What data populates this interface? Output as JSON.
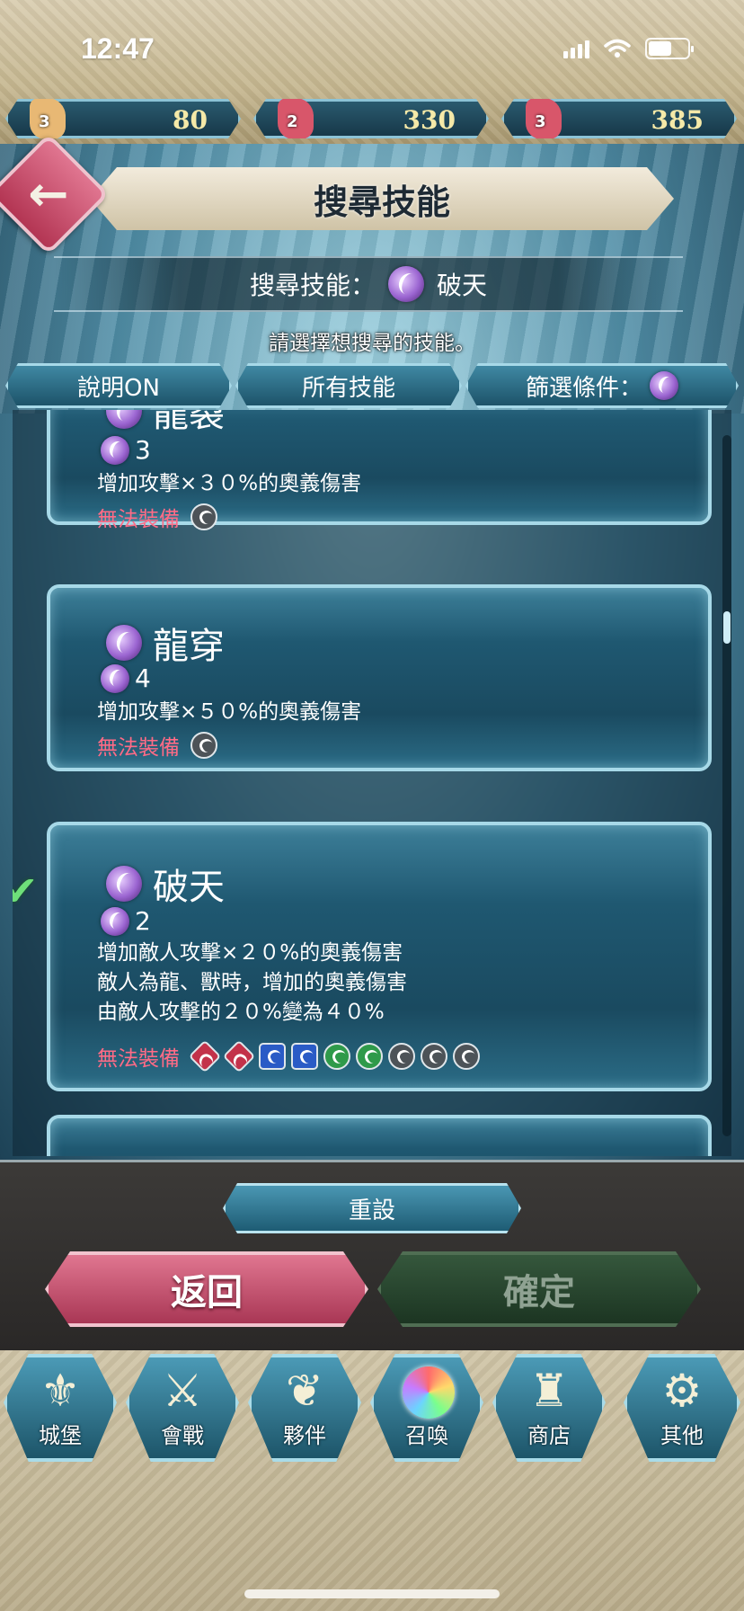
{
  "status_bar": {
    "time": "12:47"
  },
  "currencies": [
    {
      "count": "3",
      "amount": "80",
      "color": "#e8b874"
    },
    {
      "count": "2",
      "amount": "330",
      "color": "#d8566a"
    },
    {
      "count": "3",
      "amount": "385",
      "color": "#d8566a"
    }
  ],
  "header": {
    "title": "搜尋技能"
  },
  "search": {
    "label": "搜尋技能：",
    "skill_name": "破天"
  },
  "instruction": "請選擇想搜尋的技能。",
  "tabs": {
    "explain": "說明ON",
    "all_skills": "所有技能",
    "filter": "篩選條件："
  },
  "skills": [
    {
      "name": "龍裂",
      "sp": "3",
      "desc": [
        "增加攻擊×３０%的奧義傷害"
      ],
      "restriction_label": "無法裝備",
      "restricted_weapons": [
        "staff"
      ]
    },
    {
      "name": "龍穿",
      "sp": "4",
      "desc": [
        "增加攻擊×５０%的奧義傷害"
      ],
      "restriction_label": "無法裝備",
      "restricted_weapons": [
        "staff"
      ]
    },
    {
      "name": "破天",
      "sp": "2",
      "selected": true,
      "desc": [
        "增加敵人攻擊×２０%的奧義傷害",
        "敵人為龍、獸時，增加的奧義傷害",
        "由敵人攻擊的２０%變為４０%"
      ],
      "restriction_label": "無法裝備",
      "restricted_weapons": [
        "red-dragon",
        "red-beast",
        "blue-dragon",
        "blue-beast",
        "green-dragon",
        "green-beast",
        "staff",
        "colorless-dragon",
        "colorless-beast"
      ]
    }
  ],
  "buttons": {
    "reset": "重設",
    "back": "返回",
    "confirm": "確定"
  },
  "nav": [
    {
      "label": "城堡",
      "icon": "castle-crest-icon"
    },
    {
      "label": "會戰",
      "icon": "crossed-swords-icon"
    },
    {
      "label": "夥伴",
      "icon": "wing-icon"
    },
    {
      "label": "召喚",
      "icon": "orb-icon"
    },
    {
      "label": "商店",
      "icon": "shop-castle-icon"
    },
    {
      "label": "其他",
      "icon": "gear-icon"
    }
  ]
}
